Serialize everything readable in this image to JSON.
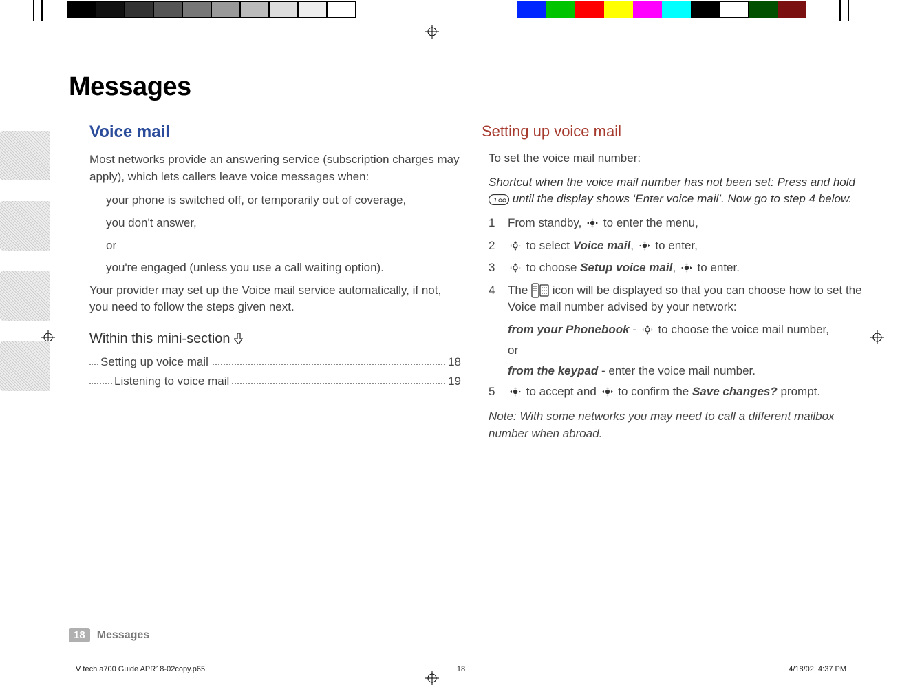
{
  "heading": "Messages",
  "left": {
    "section_title": "Voice mail",
    "intro": "Most networks provide an answering service (subscription charges may apply), which lets callers leave voice messages when:",
    "bullets": [
      "your phone is switched off, or temporarily out of coverage,",
      "you don't answer,",
      "or",
      "you're engaged (unless you use a call waiting option)."
    ],
    "outro": "Your provider may set up the Voice mail service automatically, if not, you need to follow the steps given next.",
    "mini_section_label": "Within this mini-section",
    "toc": [
      {
        "label": "Setting up voice mail",
        "page": "18"
      },
      {
        "label": "Listening to voice mail",
        "page": "19"
      }
    ]
  },
  "right": {
    "section_title": "Setting up voice mail",
    "lead": "To set the voice mail number:",
    "shortcut_pre": "Shortcut when the voice mail number has not been set: Press and hold ",
    "shortcut_post": " until the display shows ‘Enter voice mail’. Now go to step 4 below.",
    "steps": {
      "s1_pre": "From standby, ",
      "s1_post": " to enter the menu,",
      "s2_a": " to select ",
      "s2_label": "Voice mail",
      "s2_b": ", ",
      "s2_c": " to enter,",
      "s3_a": " to choose ",
      "s3_label": "Setup voice mail",
      "s3_b": ", ",
      "s3_c": " to enter.",
      "s4_a": "The ",
      "s4_b": " icon will be displayed so that you can choose how to set the Voice mail number advised by your network:",
      "s4_opt1_label": "from your Phonebook",
      "s4_opt1_rest_a": " - ",
      "s4_opt1_rest_b": " to choose the voice mail number,",
      "s4_or": "or",
      "s4_opt2_label": "from the keypad",
      "s4_opt2_rest": " - enter the voice mail number.",
      "s5_a": " to accept and ",
      "s5_b": " to confirm the ",
      "s5_label": "Save changes?",
      "s5_c": " prompt."
    },
    "note": "Note: With some networks you may need to call a different mailbox number when abroad."
  },
  "footer": {
    "page_num": "18",
    "title": "Messages"
  },
  "print": {
    "file": "V tech a700 Guide APR18-02copy.p65",
    "sheet": "18",
    "stamp": "4/18/02, 4:37 PM"
  },
  "test_bars": {
    "grays": [
      "#000",
      "#111",
      "#333",
      "#555",
      "#777",
      "#999",
      "#bbb",
      "#ddd",
      "#eee",
      "#fff"
    ],
    "colors": [
      "#0026ff",
      "#00c400",
      "#ff0000",
      "#ffff00",
      "#ff00ff",
      "#00ffff",
      "#000",
      "#fff",
      "#005000",
      "#7a1010"
    ]
  }
}
